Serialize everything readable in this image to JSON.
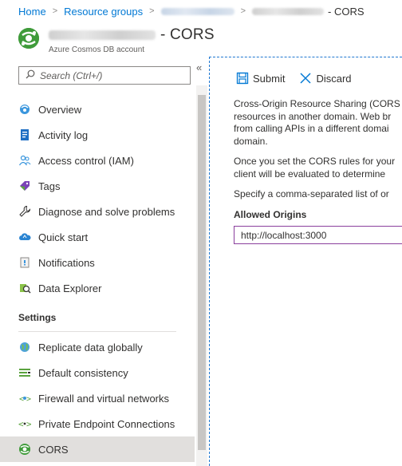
{
  "breadcrumb": {
    "home": "Home",
    "resource_groups": "Resource groups",
    "current_suffix": "- CORS"
  },
  "header": {
    "title": "- CORS",
    "subtitle": "Azure Cosmos DB account"
  },
  "sidebar": {
    "search_placeholder": "Search (Ctrl+/)",
    "collapse": "«",
    "items": [
      {
        "label": "Overview",
        "icon": "globe-icon"
      },
      {
        "label": "Activity log",
        "icon": "activity-log-icon"
      },
      {
        "label": "Access control (IAM)",
        "icon": "people-icon"
      },
      {
        "label": "Tags",
        "icon": "tag-icon"
      },
      {
        "label": "Diagnose and solve problems",
        "icon": "wrench-icon"
      },
      {
        "label": "Quick start",
        "icon": "cloud-icon"
      },
      {
        "label": "Notifications",
        "icon": "notification-icon"
      },
      {
        "label": "Data Explorer",
        "icon": "data-explorer-icon"
      }
    ],
    "settings_label": "Settings",
    "settings_items": [
      {
        "label": "Replicate data globally",
        "icon": "globe-replicate-icon"
      },
      {
        "label": "Default consistency",
        "icon": "consistency-icon"
      },
      {
        "label": "Firewall and virtual networks",
        "icon": "firewall-icon"
      },
      {
        "label": "Private Endpoint Connections",
        "icon": "endpoint-icon"
      },
      {
        "label": "CORS",
        "icon": "cosmos-icon",
        "active": true
      }
    ]
  },
  "toolbar": {
    "submit_label": "Submit",
    "discard_label": "Discard"
  },
  "content": {
    "para1_line1": "Cross-Origin Resource Sharing (CORS",
    "para1_line2": "resources in another domain. Web br",
    "para1_line3": "from calling APIs in a different domai",
    "para1_line4": "domain.",
    "para2_line1": "Once you set the CORS rules for your",
    "para2_line2": "client will be evaluated to determine",
    "para3": "Specify a comma-separated list of or",
    "allowed_origins_label": "Allowed Origins",
    "allowed_origins_value": "http://localhost:3000"
  },
  "colors": {
    "link": "#0078d4",
    "accent_blue": "#0078d4",
    "active_bg": "#e1dfdd",
    "input_border": "#8a3f9c"
  }
}
